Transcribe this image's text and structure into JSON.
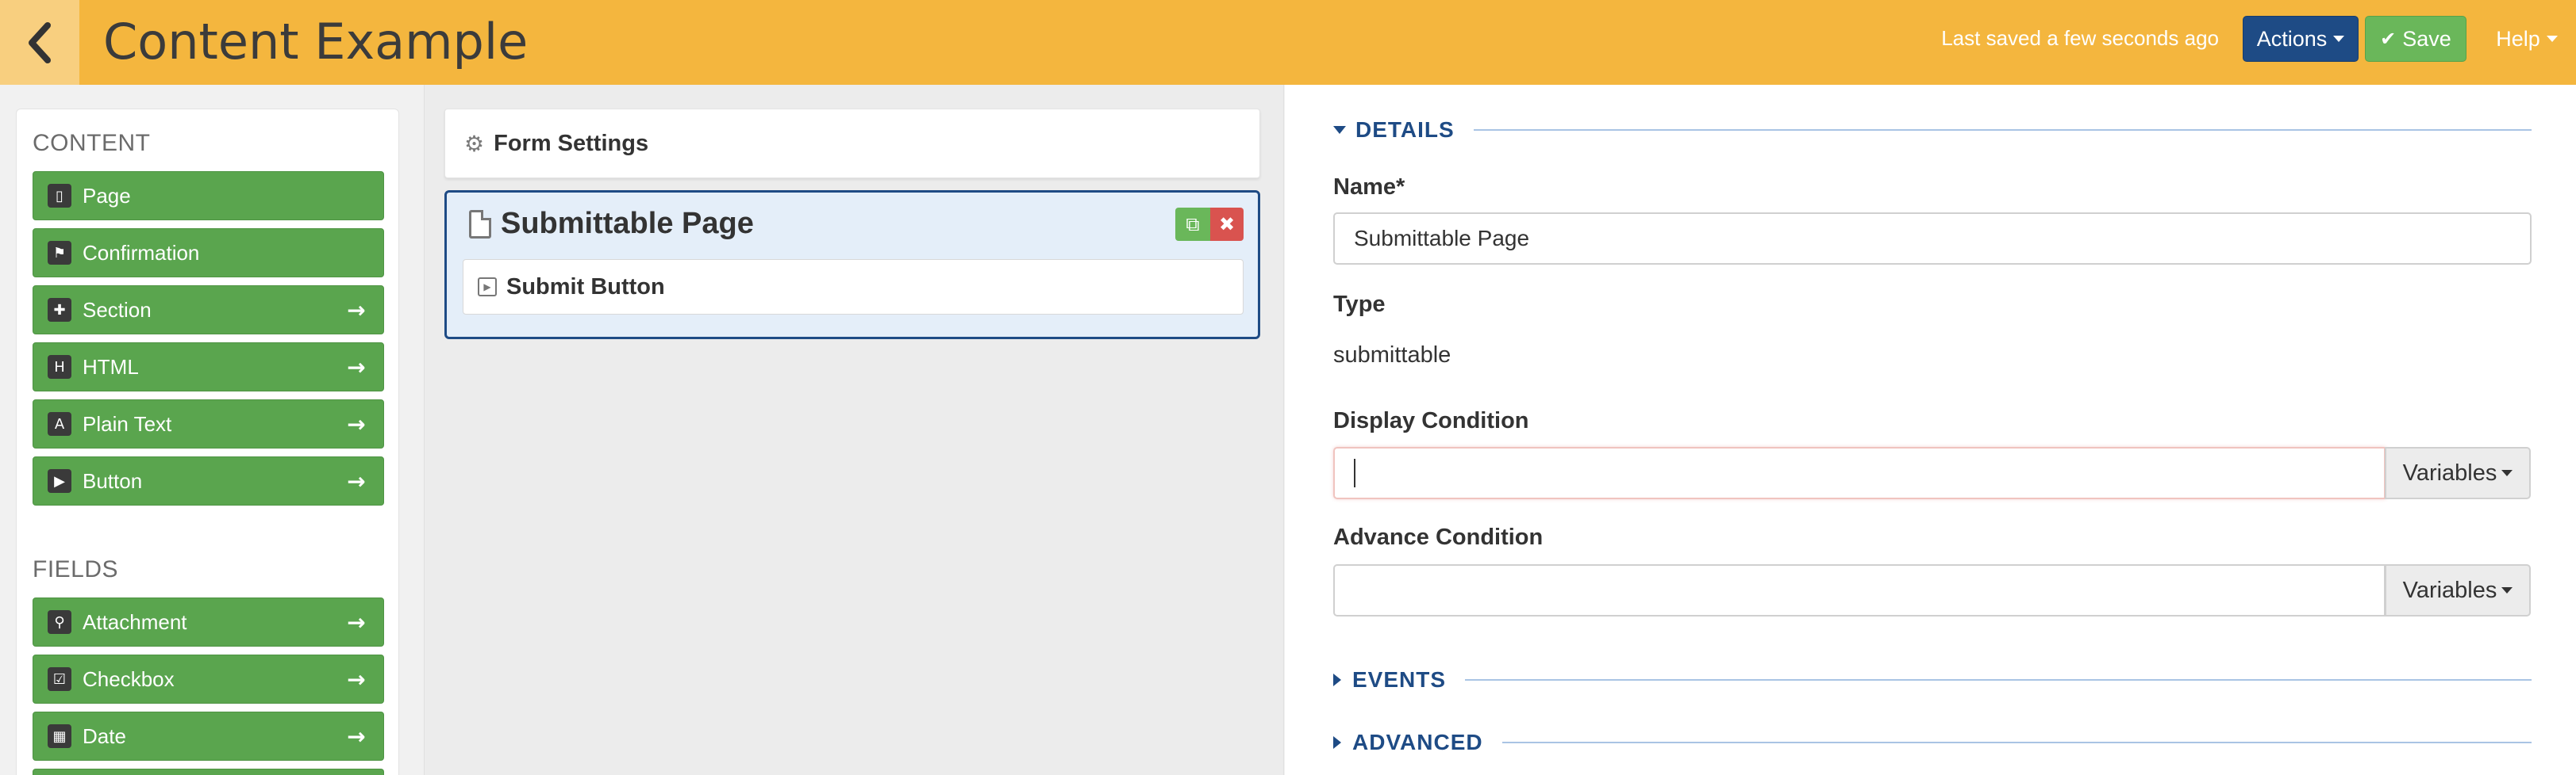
{
  "header": {
    "title": "Content Example",
    "last_saved": "Last saved a few seconds ago",
    "actions_label": "Actions",
    "save_label": "Save",
    "help_label": "Help",
    "accent_color": "#f4b63e"
  },
  "palette": {
    "content_heading": "CONTENT",
    "content_items": [
      {
        "label": "Page",
        "icon": "page-icon"
      },
      {
        "label": "Confirmation",
        "icon": "flag-icon"
      },
      {
        "label": "Section",
        "icon": "puzzle-icon"
      },
      {
        "label": "HTML",
        "icon": "html-icon"
      },
      {
        "label": "Plain Text",
        "icon": "text-icon"
      },
      {
        "label": "Button",
        "icon": "play-icon"
      }
    ],
    "fields_heading": "FIELDS",
    "field_items": [
      {
        "label": "Attachment",
        "icon": "paperclip-icon"
      },
      {
        "label": "Checkbox",
        "icon": "checkbox-icon"
      },
      {
        "label": "Date",
        "icon": "calendar-icon"
      }
    ]
  },
  "builder": {
    "form_settings_label": "Form Settings",
    "page_title": "Submittable Page",
    "submit_button_label": "Submit Button"
  },
  "details": {
    "section_title": "DETAILS",
    "name_label": "Name*",
    "name_value": "Submittable Page",
    "type_label": "Type",
    "type_value": "submittable",
    "display_condition_label": "Display Condition",
    "display_condition_value": "",
    "advance_condition_label": "Advance Condition",
    "advance_condition_value": "",
    "variables_label": "Variables",
    "events_title": "EVENTS",
    "advanced_title": "ADVANCED"
  }
}
